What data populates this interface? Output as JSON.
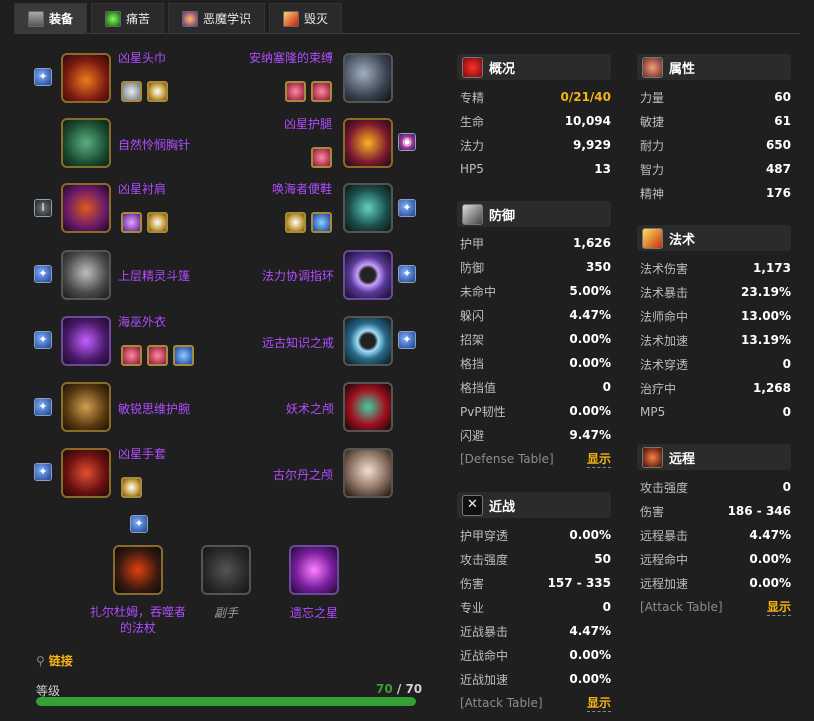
{
  "tabs": [
    {
      "label": "装备",
      "active": true,
      "icon": "gear-icon"
    },
    {
      "label": "痛苦",
      "active": false,
      "icon": "affliction-icon"
    },
    {
      "label": "恶魔学识",
      "active": false,
      "icon": "demonology-icon"
    },
    {
      "label": "毁灭",
      "active": false,
      "icon": "destruction-icon"
    }
  ],
  "items": {
    "head": "凶星头巾",
    "neck": "自然怜悯胸针",
    "shoulder": "凶星衬肩",
    "back": "上层精灵斗篷",
    "chest": "海巫外衣",
    "wrist": "敏锐思维护腕",
    "hands": "凶星手套",
    "waist": "安纳塞隆的束缚",
    "legs": "凶星护腿",
    "feet": "唤海者便鞋",
    "ring1": "法力协调指环",
    "ring2": "远古知识之戒",
    "trinket1": "妖术之颅",
    "trinket2": "古尔丹之颅",
    "mainhand": "扎尔杜姆，吞噬者的法杖",
    "offhand": "副手",
    "ranged": "遗忘之星"
  },
  "links_label": "链接",
  "level": {
    "label": "等级",
    "current": "70",
    "sep": " / ",
    "max": "70",
    "fraction": 1.0
  },
  "colors": {
    "accent": "#f3b313",
    "epic": "#b04cff",
    "progress": "#33a133"
  },
  "overview": {
    "title": "概况",
    "rows": [
      {
        "k": "专精",
        "v": "0/21/40",
        "gold": true
      },
      {
        "k": "生命",
        "v": "10,094"
      },
      {
        "k": "法力",
        "v": "9,929"
      },
      {
        "k": "HP5",
        "v": "13"
      }
    ]
  },
  "defense": {
    "title": "防御",
    "rows": [
      {
        "k": "护甲",
        "v": "1,626"
      },
      {
        "k": "防御",
        "v": "350"
      },
      {
        "k": "未命中",
        "v": "5.00%"
      },
      {
        "k": "躲闪",
        "v": "4.47%"
      },
      {
        "k": "招架",
        "v": "0.00%"
      },
      {
        "k": "格挡",
        "v": "0.00%"
      },
      {
        "k": "格挡值",
        "v": "0"
      },
      {
        "k": "PvP韧性",
        "v": "0.00%"
      },
      {
        "k": "闪避",
        "v": "9.47%"
      }
    ],
    "table_label": "[Defense Table]",
    "show_label": "显示"
  },
  "melee": {
    "title": "近战",
    "rows": [
      {
        "k": "护甲穿透",
        "v": "0.00%"
      },
      {
        "k": "攻击强度",
        "v": "50"
      },
      {
        "k": "伤害",
        "v": "157 - 335"
      },
      {
        "k": "专业",
        "v": "0"
      },
      {
        "k": "近战暴击",
        "v": "4.47%"
      },
      {
        "k": "近战命中",
        "v": "0.00%"
      },
      {
        "k": "近战加速",
        "v": "0.00%"
      }
    ],
    "table_label": "[Attack Table]",
    "show_label": "显示"
  },
  "attributes": {
    "title": "属性",
    "rows": [
      {
        "k": "力量",
        "v": "60"
      },
      {
        "k": "敏捷",
        "v": "61"
      },
      {
        "k": "耐力",
        "v": "650"
      },
      {
        "k": "智力",
        "v": "487"
      },
      {
        "k": "精神",
        "v": "176"
      }
    ]
  },
  "spell": {
    "title": "法术",
    "rows": [
      {
        "k": "法术伤害",
        "v": "1,173"
      },
      {
        "k": "法术暴击",
        "v": "23.19%"
      },
      {
        "k": "法师命中",
        "v": "13.00%"
      },
      {
        "k": "法术加速",
        "v": "13.19%"
      },
      {
        "k": "法术穿透",
        "v": "0"
      },
      {
        "k": "治疗中",
        "v": "1,268"
      },
      {
        "k": "MP5",
        "v": "0"
      }
    ]
  },
  "ranged": {
    "title": "远程",
    "rows": [
      {
        "k": "攻击强度",
        "v": "0"
      },
      {
        "k": "伤害",
        "v": "186 - 346"
      },
      {
        "k": "远程暴击",
        "v": "4.47%"
      },
      {
        "k": "远程命中",
        "v": "0.00%"
      },
      {
        "k": "远程加速",
        "v": "0.00%"
      }
    ],
    "table_label": "[Attack Table]",
    "show_label": "显示"
  }
}
